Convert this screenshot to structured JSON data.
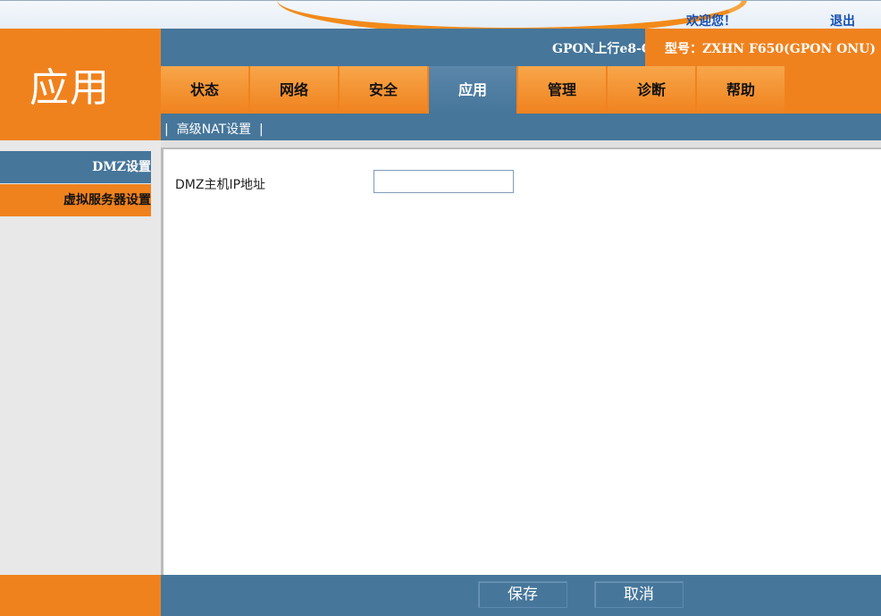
{
  "header": {
    "welcome": "欢迎您！",
    "logout": "退出",
    "product": "GPON上行e8-C",
    "model": "型号：ZXHN F650(GPON ONU)"
  },
  "page_title": "应用",
  "tabs": [
    {
      "label": "状态",
      "active": false
    },
    {
      "label": "网络",
      "active": false
    },
    {
      "label": "安全",
      "active": false
    },
    {
      "label": "应用",
      "active": true
    },
    {
      "label": "管理",
      "active": false
    },
    {
      "label": "诊断",
      "active": false
    },
    {
      "label": "帮助",
      "active": false
    }
  ],
  "subnav": {
    "label": "|  高级NAT设置  |"
  },
  "sidebar": {
    "items": [
      {
        "label": "DMZ设置",
        "active": true
      },
      {
        "label": "虚拟服务器设置",
        "active": false
      }
    ]
  },
  "form": {
    "dmz_label": "DMZ主机IP地址",
    "dmz_value": ""
  },
  "buttons": {
    "save": "保存",
    "cancel": "取消"
  },
  "colors": {
    "orange": "#f0821e",
    "blue": "#46769a",
    "link_blue": "#1650b0"
  }
}
